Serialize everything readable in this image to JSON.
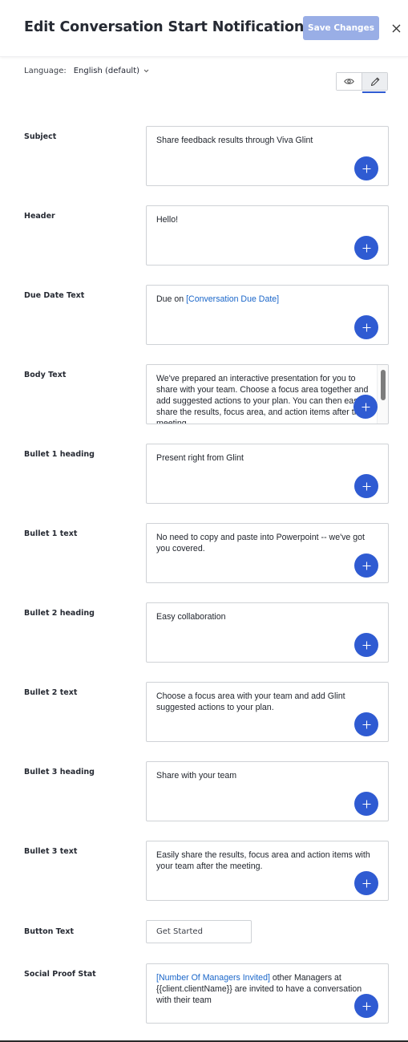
{
  "header": {
    "title": "Edit Conversation Start Notification",
    "save_label": "Save Changes",
    "close_icon": "close-icon"
  },
  "language": {
    "label": "Language:",
    "value": "English (default)"
  },
  "view_toggle": {
    "preview_icon": "eye-icon",
    "edit_icon": "pencil-icon",
    "active": "edit"
  },
  "fields": [
    {
      "label": "Subject",
      "segments": [
        {
          "text": "Share feedback results through Viva Glint",
          "token": false
        }
      ]
    },
    {
      "label": "Header",
      "segments": [
        {
          "text": "Hello!",
          "token": false
        }
      ]
    },
    {
      "label": "Due Date Text",
      "segments": [
        {
          "text": "Due on ",
          "token": false
        },
        {
          "text": "[Conversation Due Date]",
          "token": true
        }
      ]
    },
    {
      "label": "Body Text",
      "segments": [
        {
          "text": "We've prepared an interactive presentation for you to share with your team. Choose a focus area together and add suggested actions to your plan. You can then easily share the results, focus area, and action items after the meeting.",
          "token": false
        }
      ]
    },
    {
      "label": "Bullet 1 heading",
      "segments": [
        {
          "text": "Present right from Glint",
          "token": false
        }
      ]
    },
    {
      "label": "Bullet 1 text",
      "segments": [
        {
          "text": "No need to copy and paste into Powerpoint -- we've got you covered.",
          "token": false
        }
      ]
    },
    {
      "label": "Bullet 2 heading",
      "segments": [
        {
          "text": "Easy collaboration",
          "token": false
        }
      ]
    },
    {
      "label": "Bullet 2 text",
      "segments": [
        {
          "text": "Choose a focus area with your team and add Glint suggested actions to your plan.",
          "token": false
        }
      ]
    },
    {
      "label": "Bullet 3 heading",
      "segments": [
        {
          "text": "Share with your team",
          "token": false
        }
      ]
    },
    {
      "label": "Bullet 3 text",
      "segments": [
        {
          "text": "Easily share the results, focus area and action items with your team after the meeting.",
          "token": false
        }
      ]
    }
  ],
  "button_text": {
    "label": "Button Text",
    "value": "Get Started"
  },
  "social_proof": {
    "label": "Social Proof Stat",
    "segments": [
      {
        "text": "[Number Of Managers Invited]",
        "token": true
      },
      {
        "text": " other Managers at {{client.clientName}} are invited to have a conversation with their team",
        "token": false
      }
    ]
  },
  "colors": {
    "accent": "#2f5bd2",
    "save_disabled": "#99aee6",
    "token_link": "#1a66c9"
  }
}
